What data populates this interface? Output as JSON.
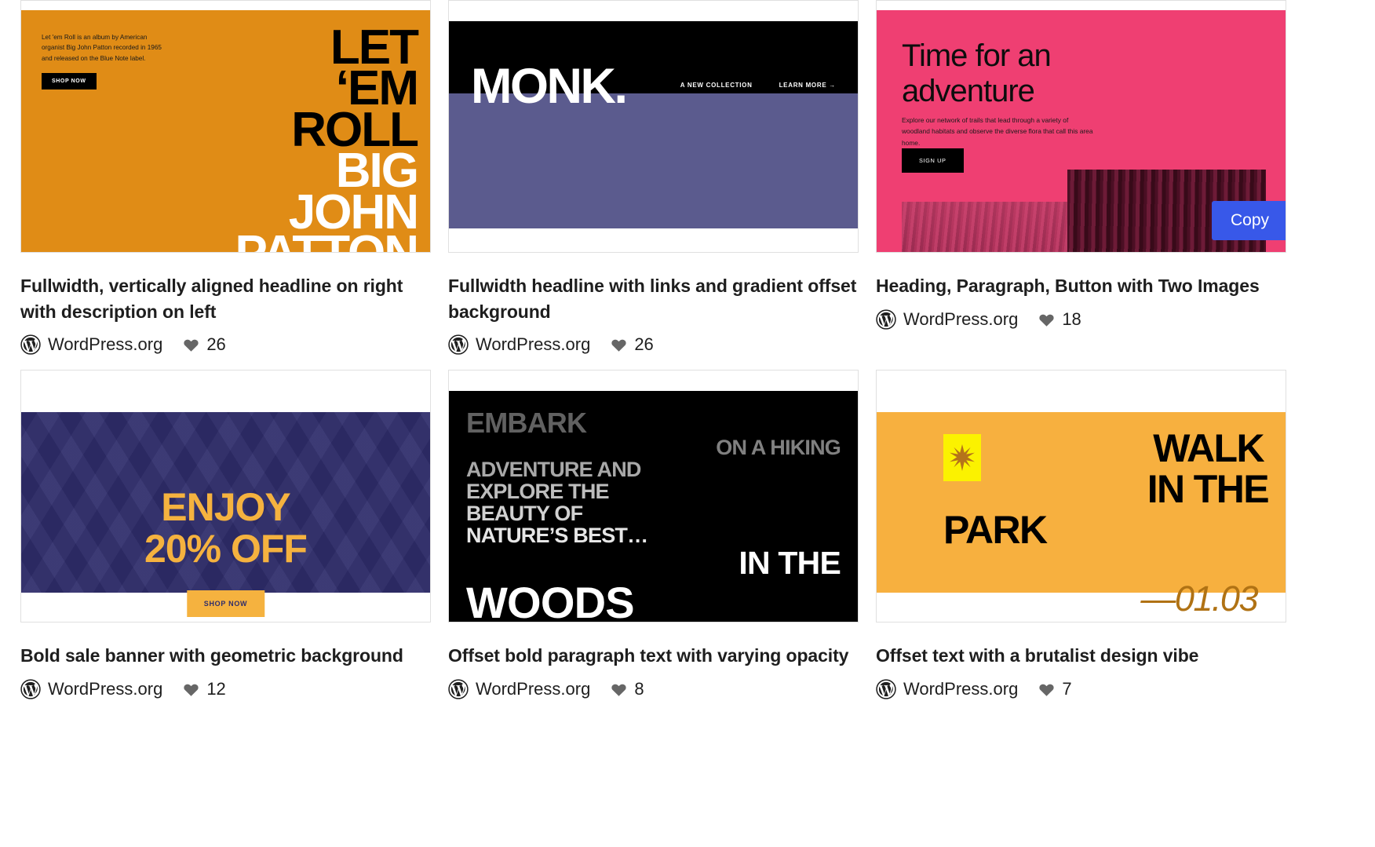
{
  "grid": {
    "cards": [
      {
        "title": "Fullwidth, vertically aligned headline on right with description on left",
        "author": "WordPress.org",
        "likes": "26",
        "preview": {
          "kind": "letem-roll",
          "description": "Let 'em Roll is an album by American organist Big John Patton recorded in 1965 and released on the Blue Note label.",
          "button": "SHOP NOW",
          "headline_dark": [
            "LET",
            "‘EM",
            "ROLL"
          ],
          "headline_light": [
            "BIG",
            "JOHN",
            "PATTON"
          ],
          "bg_color": "#e08c16"
        }
      },
      {
        "title": "Fullwidth headline with links and gradient offset background",
        "author": "WordPress.org",
        "likes": "26",
        "preview": {
          "kind": "monk",
          "title": "MONK.",
          "link_1": "A NEW COLLECTION",
          "link_2": "LEARN MORE  →",
          "band_color": "#000000",
          "offset_color": "#5b5b8e"
        }
      },
      {
        "title": "Heading, Paragraph, Button with Two Images",
        "author": "WordPress.org",
        "likes": "18",
        "preview": {
          "kind": "adventure",
          "heading": "Time for an adventure",
          "paragraph": "Explore our network of trails that lead through a variety of woodland habitats and observe the diverse flora that call this area home.",
          "button": "SIGN UP",
          "bg_color": "#ef3f72"
        },
        "copy_button": "Copy",
        "copy_button_color": "#3858e9"
      },
      {
        "title": "Bold sale banner with geometric background",
        "author": "WordPress.org",
        "likes": "12",
        "preview": {
          "kind": "enjoy-sale",
          "headline_line_1": "ENJOY",
          "headline_line_2": "20% OFF",
          "button": "SHOP NOW",
          "bg_color": "#2f2d6b",
          "accent_color": "#f5b23f"
        }
      },
      {
        "title": "Offset bold paragraph text with varying opacity",
        "author": "WordPress.org",
        "likes": "8",
        "preview": {
          "kind": "embark",
          "lines": [
            "EMBARK",
            "ON A HIKING",
            "ADVENTURE AND",
            "EXPLORE THE",
            "BEAUTY OF",
            "NATURE’S BEST…",
            "IN THE",
            "WOODS"
          ],
          "bg_color": "#000000"
        }
      },
      {
        "title": "Offset text with a brutalist design vibe",
        "author": "WordPress.org",
        "likes": "7",
        "preview": {
          "kind": "walk-park",
          "line_1": "WALK",
          "line_2": "IN THE",
          "line_3": "PARK",
          "date": "—01.03",
          "star": "✶",
          "bg_color": "#f7b03f",
          "star_bg_color": "#fbf200"
        }
      }
    ]
  }
}
